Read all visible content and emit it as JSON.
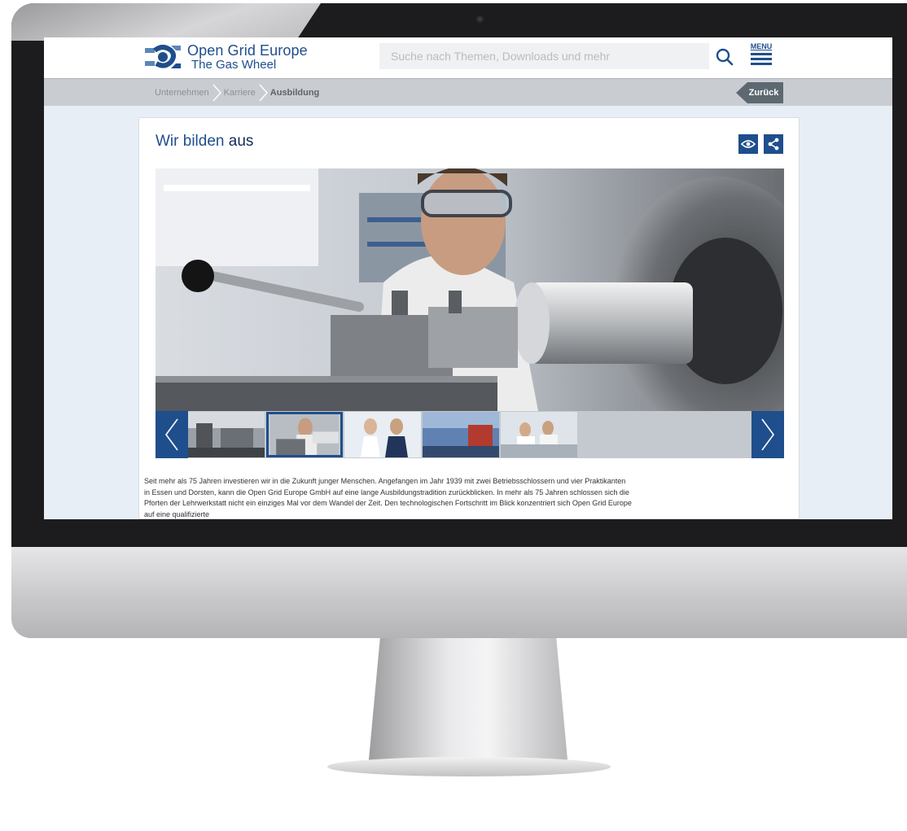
{
  "header": {
    "logo_name": "Open Grid Europe",
    "logo_tagline": "The Gas Wheel",
    "search_placeholder": "Suche nach Themen, Downloads und mehr",
    "menu_label": "MENU"
  },
  "breadcrumb": {
    "items": [
      {
        "label": "Unternehmen"
      },
      {
        "label": "Karriere"
      },
      {
        "label": "Ausbildung"
      }
    ],
    "back_label": "Zurück"
  },
  "page": {
    "title_part1": "Wir bilden",
    "title_part2": "aus",
    "body": "Seit mehr als 75 Jahren investieren wir in die Zukunft junger Menschen. Angefangen im Jahr 1939 mit zwei Betriebsschlossern und vier Praktikanten in Essen und Dorsten, kann die Open Grid Europe GmbH auf eine lange Ausbildungstradition zurückblicken. In mehr als 75 Jahren schlossen sich die Pforten der Lehrwerkstatt nicht ein einziges Mal vor dem Wandel der Zeit. Den technologischen Fortschritt im Blick konzentriert sich Open Grid Europe auf eine qualifizierte"
  },
  "gallery": {
    "selected_index": 1,
    "thumbnail_count": 5
  },
  "colors": {
    "brand_blue": "#1f4e8c",
    "breadcrumb_bar": "#c9cdd2",
    "page_background": "#e8eef6"
  },
  "icons": [
    "search-icon",
    "menu-icon",
    "eye-icon",
    "share-icon",
    "chevron-left-icon",
    "chevron-right-icon",
    "camera-icon"
  ]
}
